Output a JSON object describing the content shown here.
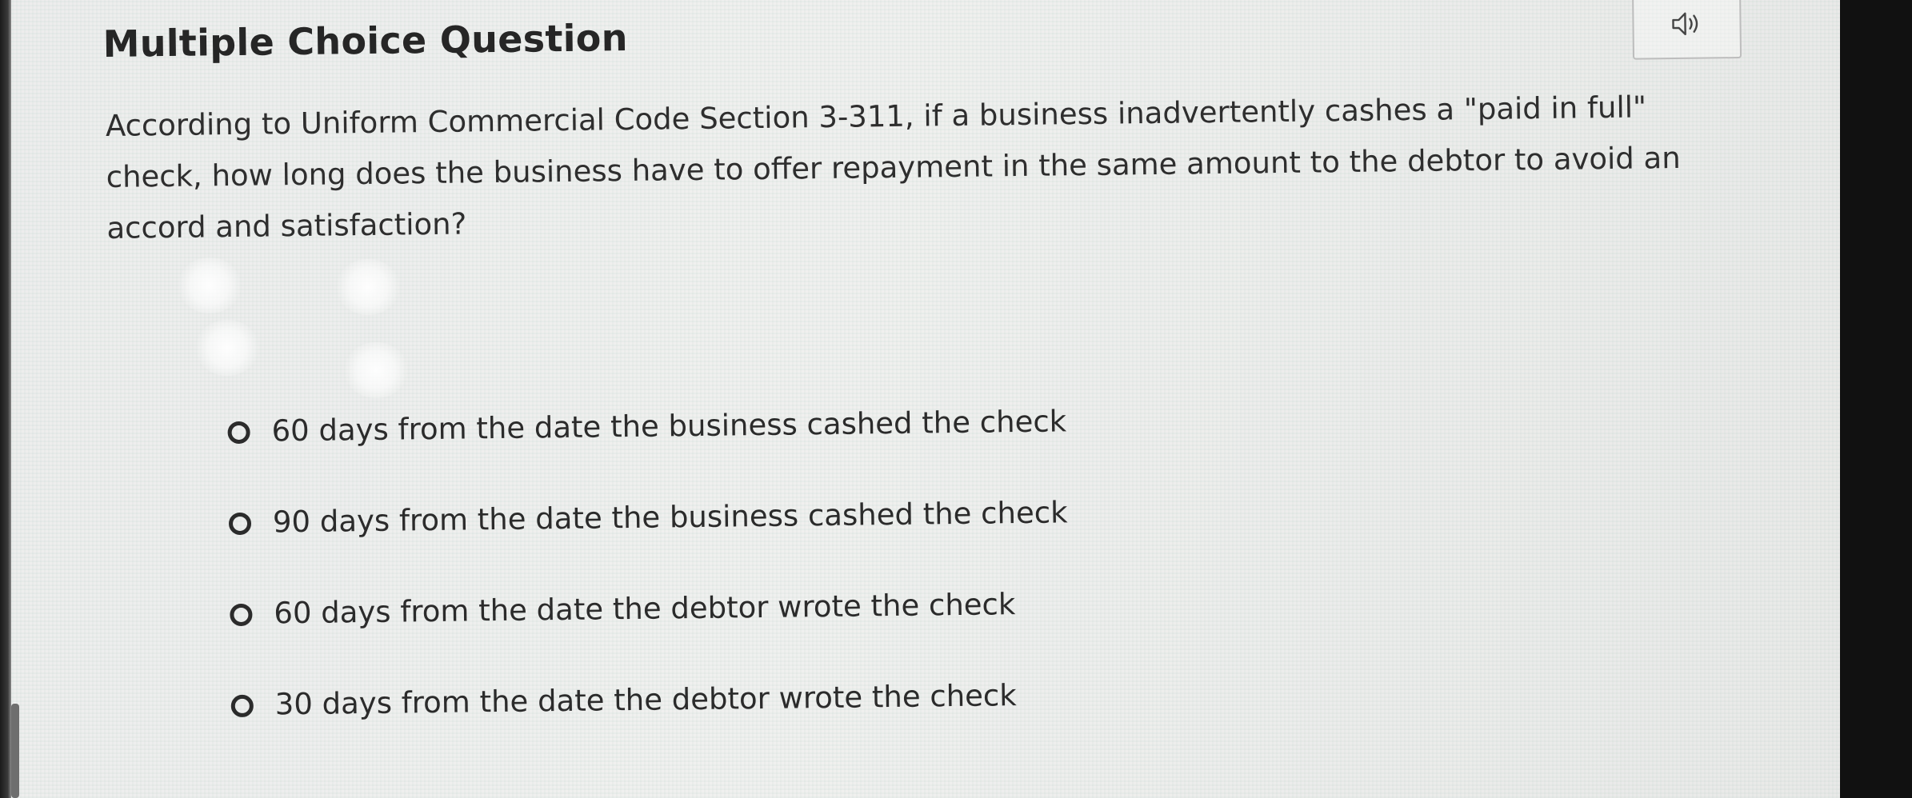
{
  "page": {
    "title": "Multiple Choice Question"
  },
  "toolbar": {
    "audio_icon": "speaker-icon"
  },
  "question": {
    "text": "According to Uniform Commercial Code Section 3-311, if a business inadvertently cashes a \"paid in full\" check, how long does the business have to offer repayment in the same amount to the debtor to avoid an accord and satisfaction?"
  },
  "choices": [
    {
      "label": "60 days from the date the business cashed the check",
      "selected": false
    },
    {
      "label": "90 days from the date the business cashed the check",
      "selected": false
    },
    {
      "label": "60 days from the date the debtor wrote the check",
      "selected": false
    },
    {
      "label": "30 days from the date the debtor wrote the check",
      "selected": false
    }
  ],
  "colors": {
    "text": "#2b2b2b",
    "background": "#ededed",
    "border": "#bdbdbd"
  }
}
